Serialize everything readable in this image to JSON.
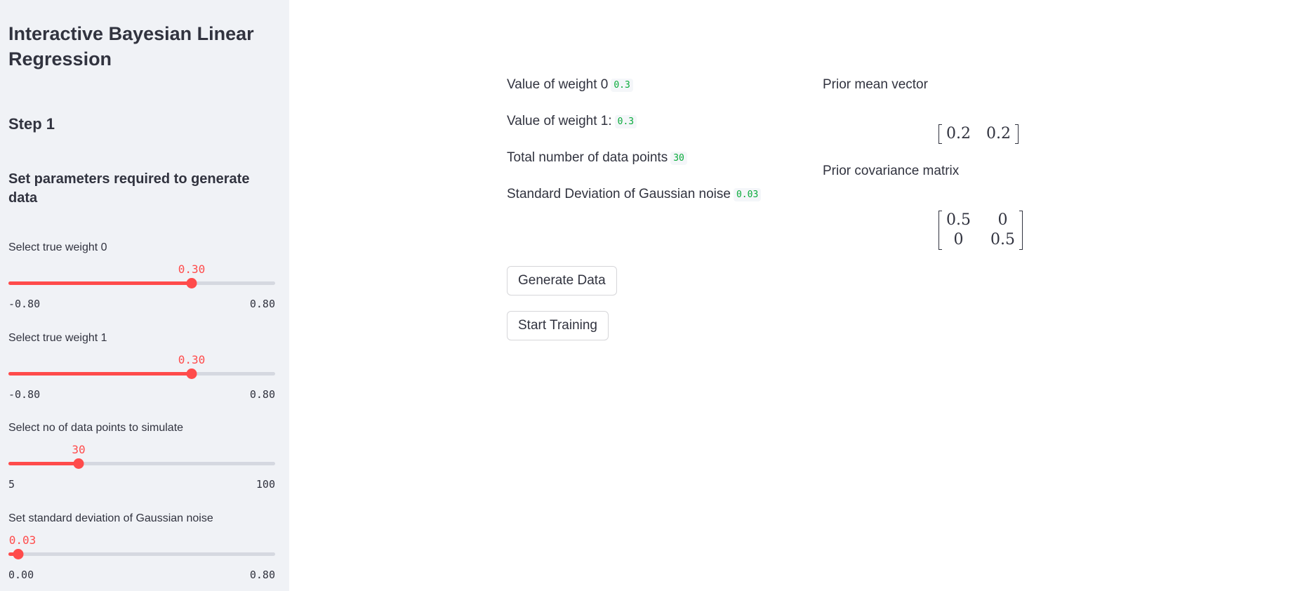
{
  "sidebar": {
    "title": "Interactive Bayesian Linear Regression",
    "step": "Step 1",
    "subheader": "Set parameters required to generate data",
    "sliders": [
      {
        "label": "Select true weight 0",
        "value_text": "0.30",
        "min_text": "-0.80",
        "max_text": "0.80",
        "fraction": 0.6875
      },
      {
        "label": "Select true weight 1",
        "value_text": "0.30",
        "min_text": "-0.80",
        "max_text": "0.80",
        "fraction": 0.6875
      },
      {
        "label": "Select no of data points to simulate",
        "value_text": "30",
        "min_text": "5",
        "max_text": "100",
        "fraction": 0.2632
      },
      {
        "label": "Set standard deviation of Gaussian noise",
        "value_text": "0.03",
        "min_text": "0.00",
        "max_text": "0.80",
        "fraction": 0.0375
      }
    ]
  },
  "main": {
    "info": [
      {
        "text": "Value of weight 0",
        "code": "0.3"
      },
      {
        "text": "Value of weight 1:",
        "code": "0.3"
      },
      {
        "text": "Total number of data points",
        "code": "30"
      },
      {
        "text": "Standard Deviation of Gaussian noise",
        "code": "0.03"
      }
    ],
    "buttons": {
      "generate": "Generate Data",
      "train": "Start Training"
    },
    "prior_mean_label": "Prior mean vector",
    "prior_mean": [
      "0.2",
      "0.2"
    ],
    "prior_cov_label": "Prior covariance matrix",
    "prior_cov": [
      [
        "0.5",
        "0"
      ],
      [
        "0",
        "0.5"
      ]
    ]
  },
  "colors": {
    "accent": "#ff4b4b",
    "code_text": "#09ab3b",
    "sidebar_bg": "#f0f2f6",
    "text": "#31333f"
  }
}
